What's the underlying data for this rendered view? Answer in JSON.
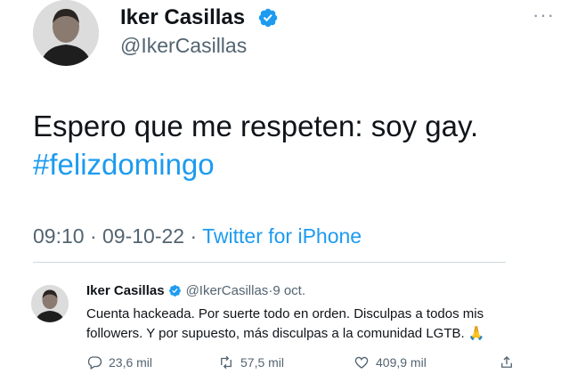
{
  "tweet": {
    "author_name": "Iker Casillas",
    "author_handle": "@IkerCasillas",
    "text": "Espero que me respeten: soy gay.",
    "hashtag": "#felizdomingo",
    "time": "09:10",
    "date": "09-10-22",
    "separator": " · ",
    "source": "Twitter for iPhone",
    "more_label": "···"
  },
  "reply": {
    "author_name": "Iker Casillas",
    "author_handle": "@IkerCasillas",
    "dot": " · ",
    "date": "9 oct.",
    "text": "Cuenta hackeada. Por suerte todo en orden. Disculpas a todos mis followers. Y por supuesto, más disculpas a la comunidad LGTB. 🙏",
    "replies": "23,6 mil",
    "retweets": "57,5 mil",
    "likes": "409,9 mil"
  },
  "colors": {
    "accent": "#1d9bf0",
    "muted": "#536471",
    "text": "#0f1419"
  }
}
